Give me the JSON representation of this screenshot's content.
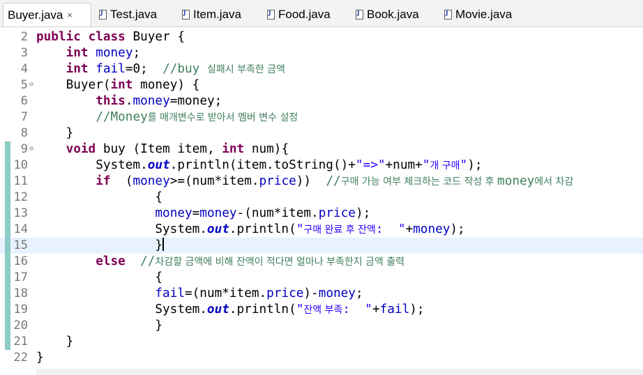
{
  "tabs": [
    {
      "name": "Buyer.java",
      "active": true,
      "close_icon": "×"
    },
    {
      "name": "Test.java",
      "active": false
    },
    {
      "name": "Item.java",
      "active": false
    },
    {
      "name": "Food.java",
      "active": false
    },
    {
      "name": "Book.java",
      "active": false
    },
    {
      "name": "Movie.java",
      "active": false
    }
  ],
  "colors": {
    "keyword": "#7f0055",
    "field": "#0000c0",
    "comment": "#3f7f5f",
    "string": "#2a00ff",
    "line_number": "#787878",
    "current_line": "#e8f2fe",
    "change_bar": "#8ccbc6"
  },
  "lines": [
    {
      "num": "2",
      "tokens": [
        [
          "kw",
          "public"
        ],
        [
          "",
          "",
          ""
        ],
        [
          "",
          ""
        ],
        [
          "kw",
          "class"
        ],
        [
          "",
          "Buyer {"
        ]
      ]
    },
    {
      "num": "3",
      "tokens": [
        [
          "",
          "    "
        ],
        [
          "kw",
          "int"
        ],
        [
          "",
          " "
        ],
        [
          "fld",
          "money"
        ],
        [
          "",
          ";"
        ]
      ]
    },
    {
      "num": "4",
      "tokens": [
        [
          "",
          "    "
        ],
        [
          "kw",
          "int"
        ],
        [
          "",
          " "
        ],
        [
          "fld",
          "fail"
        ],
        [
          "",
          "=0;  "
        ],
        [
          "cm",
          "//buy "
        ],
        [
          "cmko",
          "실패시 부족한 금액"
        ]
      ]
    },
    {
      "num": "5",
      "fold": true,
      "tokens": [
        [
          "",
          "    Buyer("
        ],
        [
          "kw",
          "int"
        ],
        [
          "",
          " money) {"
        ]
      ]
    },
    {
      "num": "6",
      "tokens": [
        [
          "",
          "        "
        ],
        [
          "kw",
          "this"
        ],
        [
          "",
          "."
        ],
        [
          "fld",
          "money"
        ],
        [
          "",
          "=money;"
        ]
      ]
    },
    {
      "num": "7",
      "tokens": [
        [
          "",
          "        "
        ],
        [
          "cm",
          "//Money"
        ],
        [
          "cmko",
          "를 매개변수로 받아서 멤버 변수 설정"
        ]
      ]
    },
    {
      "num": "8",
      "tokens": [
        [
          "",
          "    }"
        ]
      ]
    },
    {
      "num": "9",
      "fold": true,
      "changed": true,
      "tokens": [
        [
          "",
          "    "
        ],
        [
          "kw",
          "void"
        ],
        [
          "",
          " buy (Item item, "
        ],
        [
          "kw",
          "int"
        ],
        [
          "",
          " num){"
        ]
      ]
    },
    {
      "num": "10",
      "changed": true,
      "tokens": [
        [
          "",
          "        System."
        ],
        [
          "sfld",
          "out"
        ],
        [
          "",
          ".println(item.toString()+"
        ],
        [
          "str",
          "\"=>\""
        ],
        [
          "",
          "+num+"
        ],
        [
          "str",
          "\""
        ],
        [
          "strko",
          "개 구매"
        ],
        [
          "str",
          "\""
        ],
        [
          "",
          ");"
        ]
      ]
    },
    {
      "num": "11",
      "changed": true,
      "tokens": [
        [
          "",
          "        "
        ],
        [
          "kw",
          "if"
        ],
        [
          "",
          "  ("
        ],
        [
          "fld",
          "money"
        ],
        [
          "",
          ">=(num*item."
        ],
        [
          "fld",
          "price"
        ],
        [
          "",
          "))  "
        ],
        [
          "cm",
          "//"
        ],
        [
          "cmko",
          "구매 가능 여부 체크하는 코드 작성 후 "
        ],
        [
          "cm",
          "money"
        ],
        [
          "cmko",
          "에서 차감"
        ]
      ]
    },
    {
      "num": "12",
      "changed": true,
      "tokens": [
        [
          "",
          "                {"
        ]
      ]
    },
    {
      "num": "13",
      "changed": true,
      "tokens": [
        [
          "",
          "                "
        ],
        [
          "fld",
          "money"
        ],
        [
          "",
          "="
        ],
        [
          "fld",
          "money"
        ],
        [
          "",
          "-(num*item."
        ],
        [
          "fld",
          "price"
        ],
        [
          "",
          ");"
        ]
      ]
    },
    {
      "num": "14",
      "changed": true,
      "tokens": [
        [
          "",
          "                System."
        ],
        [
          "sfld",
          "out"
        ],
        [
          "",
          ".println("
        ],
        [
          "str",
          "\""
        ],
        [
          "strko",
          "구매 완료 후 잔액"
        ],
        [
          "str",
          ":  \""
        ],
        [
          "",
          "+"
        ],
        [
          "fld",
          "money"
        ],
        [
          "",
          ");"
        ]
      ]
    },
    {
      "num": "15",
      "changed": true,
      "current": true,
      "tokens": [
        [
          "",
          "                }"
        ]
      ]
    },
    {
      "num": "16",
      "changed": true,
      "tokens": [
        [
          "",
          "        "
        ],
        [
          "kw",
          "else"
        ],
        [
          "",
          "  "
        ],
        [
          "cm",
          "//"
        ],
        [
          "cmko",
          "차감할 금액에 비해 잔액이 적다면 얼마나 부족한지 금액 출력"
        ]
      ]
    },
    {
      "num": "17",
      "changed": true,
      "tokens": [
        [
          "",
          "                {"
        ]
      ]
    },
    {
      "num": "18",
      "changed": true,
      "tokens": [
        [
          "",
          "                "
        ],
        [
          "fld",
          "fail"
        ],
        [
          "",
          "=(num*item."
        ],
        [
          "fld",
          "price"
        ],
        [
          "",
          ")-"
        ],
        [
          "fld",
          "money"
        ],
        [
          "",
          ";"
        ]
      ]
    },
    {
      "num": "19",
      "changed": true,
      "tokens": [
        [
          "",
          "                System."
        ],
        [
          "sfld",
          "out"
        ],
        [
          "",
          ".println("
        ],
        [
          "str",
          "\""
        ],
        [
          "strko",
          "잔액 부족"
        ],
        [
          "str",
          ":  \""
        ],
        [
          "",
          "+"
        ],
        [
          "fld",
          "fail"
        ],
        [
          "",
          ");"
        ]
      ]
    },
    {
      "num": "20",
      "changed": true,
      "tokens": [
        [
          "",
          "                }"
        ]
      ]
    },
    {
      "num": "21",
      "changed": true,
      "tokens": [
        [
          "",
          "    }"
        ]
      ]
    },
    {
      "num": "22",
      "tokens": [
        [
          "",
          "}"
        ]
      ]
    }
  ]
}
